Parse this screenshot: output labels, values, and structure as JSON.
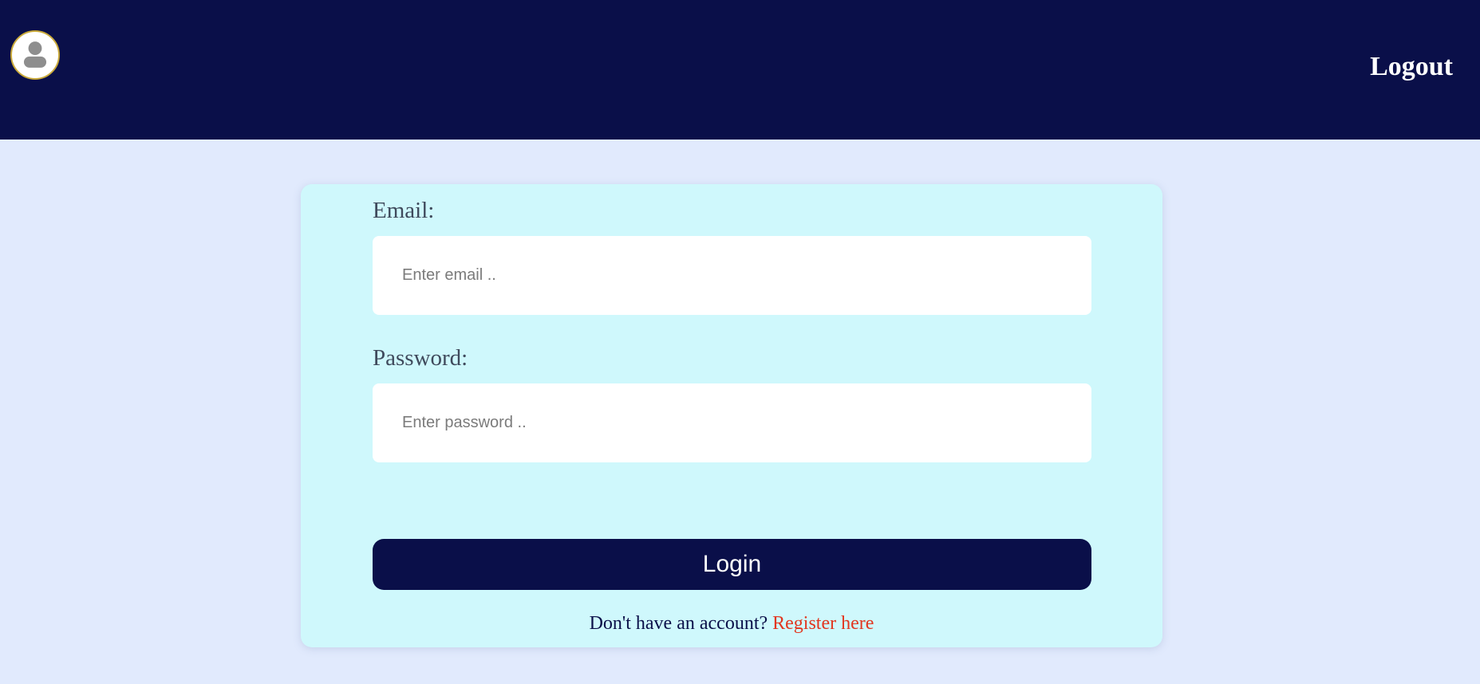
{
  "header": {
    "avatar_icon": "user-avatar-icon",
    "logout_label": "Logout"
  },
  "login_form": {
    "email_label": "Email:",
    "email_placeholder": "Enter email ..",
    "email_value": "",
    "password_label": "Password:",
    "password_placeholder": "Enter password ..",
    "password_value": "",
    "login_button_label": "Login",
    "register_prompt": "Don't have an account?",
    "register_link_label": "Register here"
  },
  "colors": {
    "header_bg": "#0a0f49",
    "page_bg": "#e1eafd",
    "card_bg": "#cff8fc",
    "button_bg": "#0a0f49",
    "link_color": "#e2361f"
  }
}
